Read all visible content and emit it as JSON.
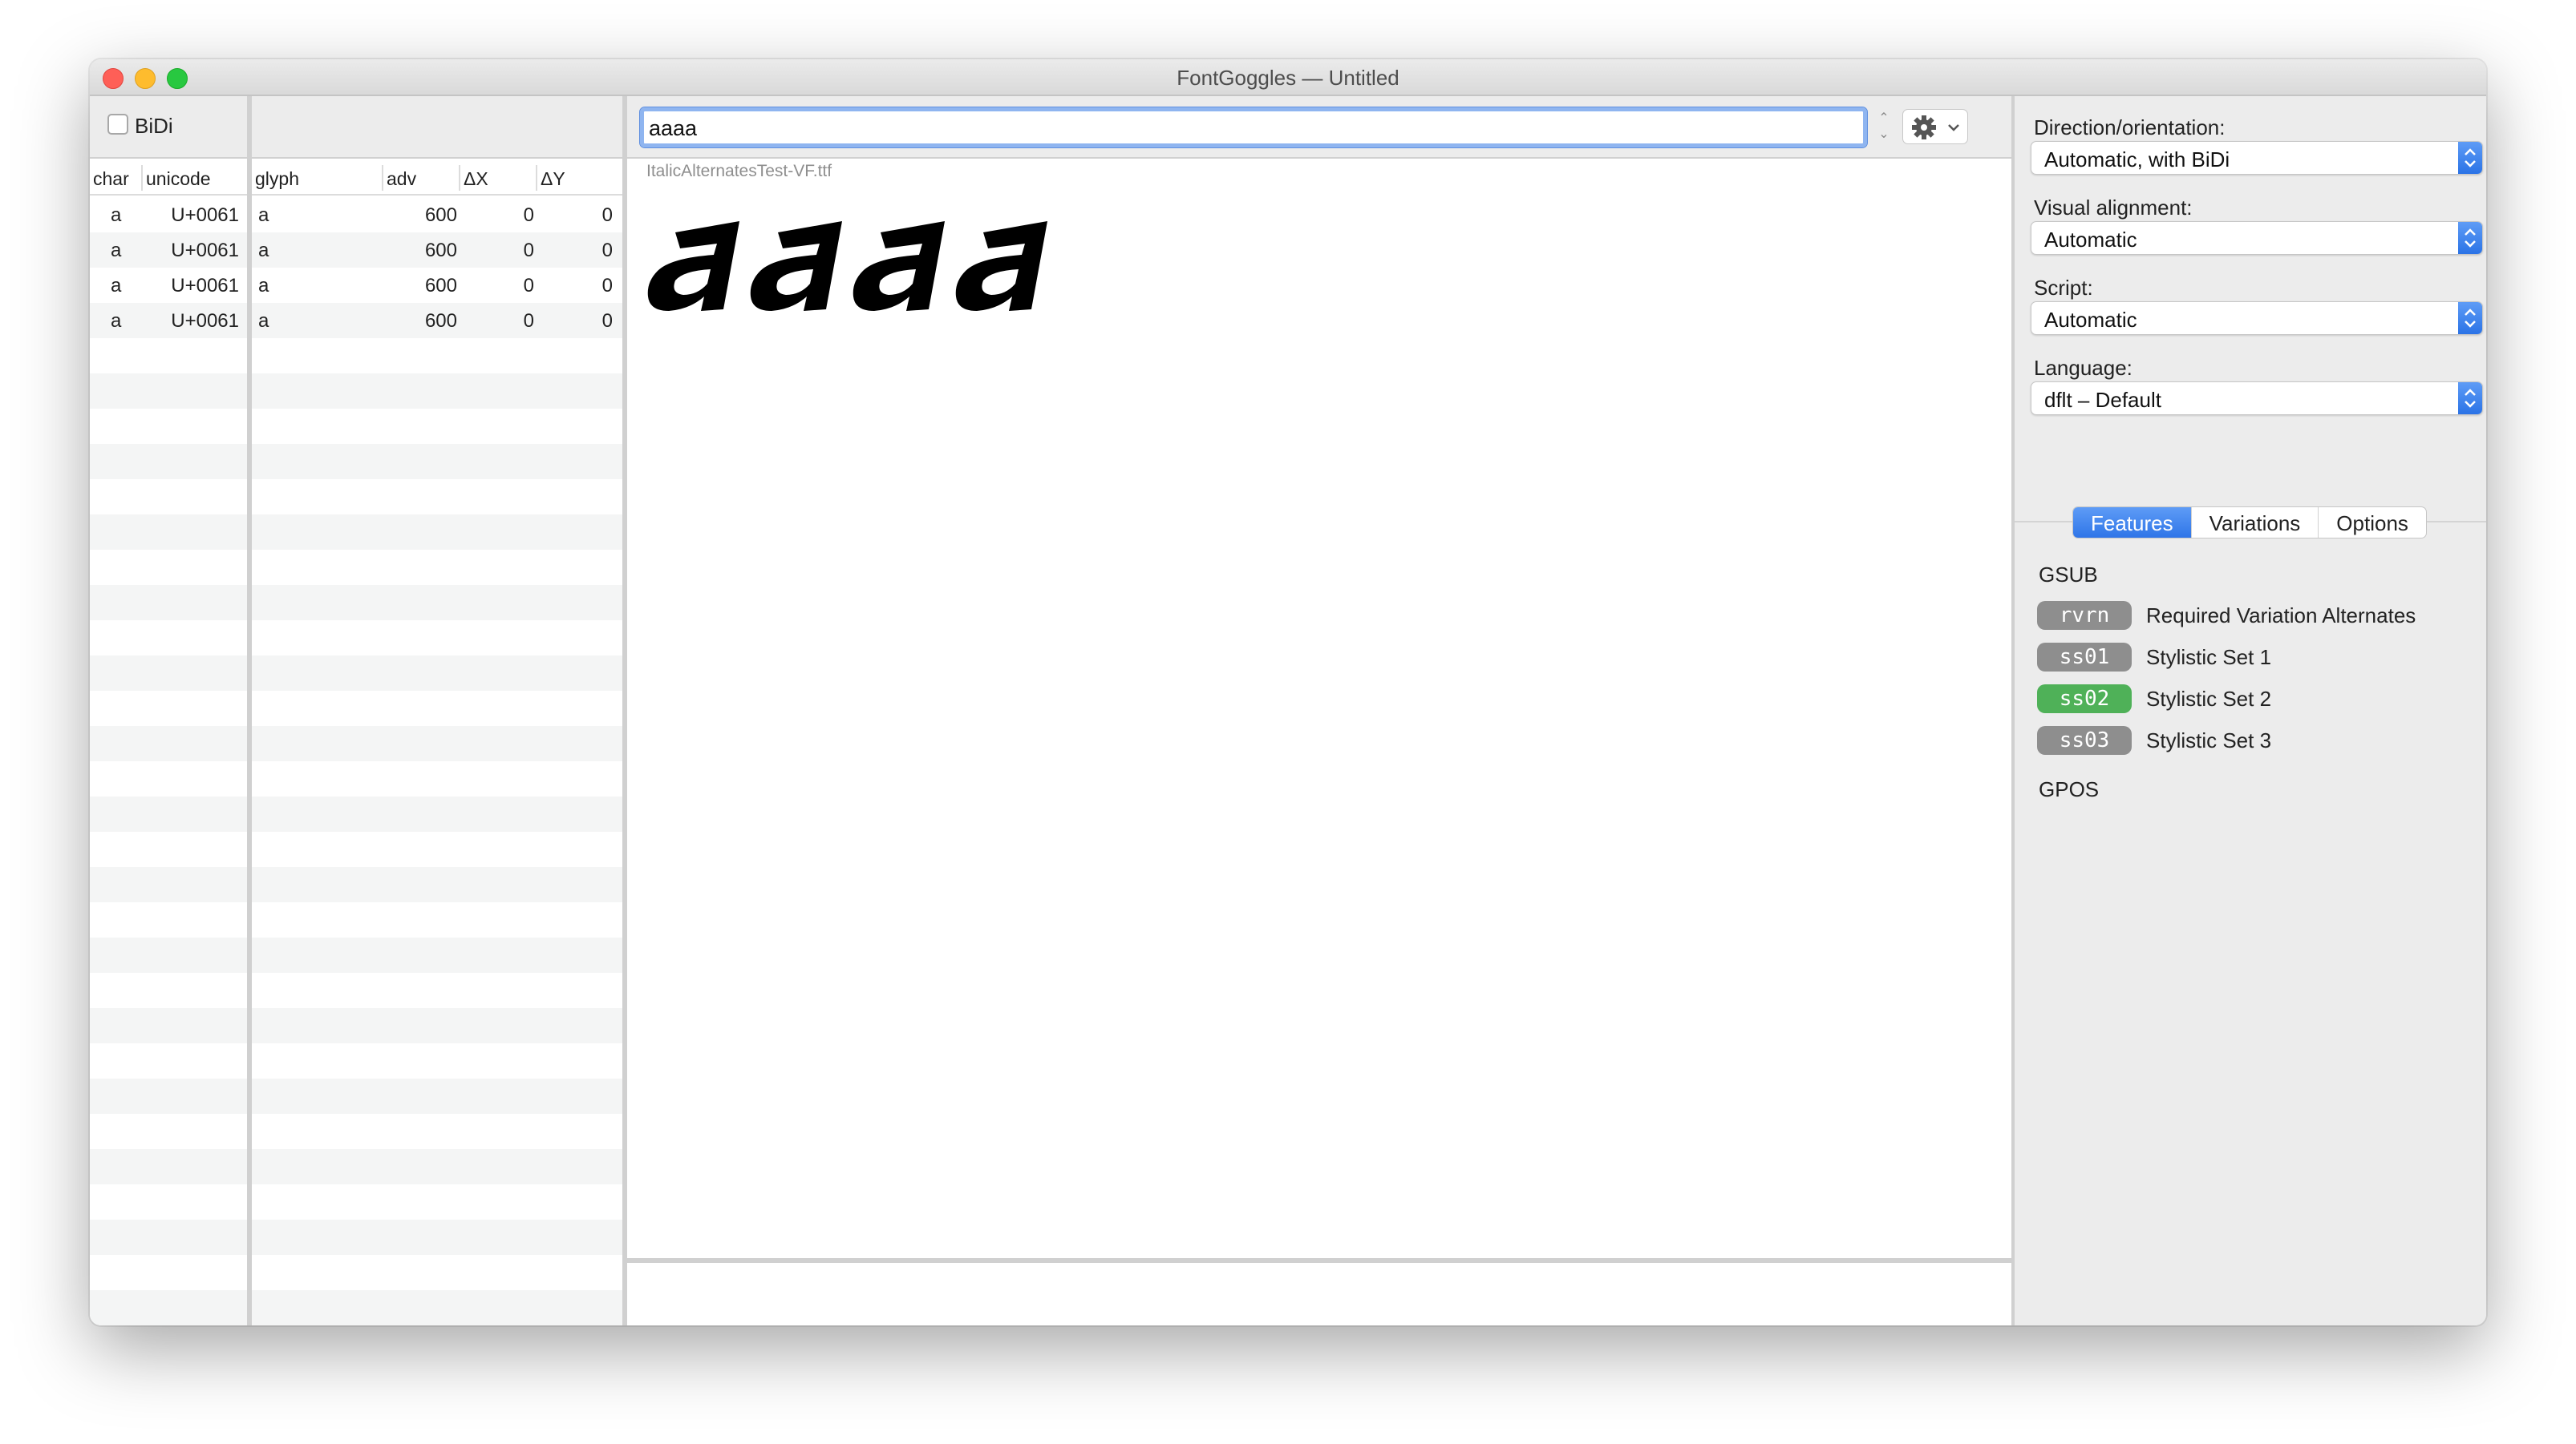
{
  "window": {
    "title": "FontGoggles — Untitled"
  },
  "bidi": {
    "label": "BiDi",
    "checked": false
  },
  "char_table": {
    "headers": [
      "char",
      "unicode"
    ],
    "rows": [
      {
        "char": "a",
        "unicode": "U+0061"
      },
      {
        "char": "a",
        "unicode": "U+0061"
      },
      {
        "char": "a",
        "unicode": "U+0061"
      },
      {
        "char": "a",
        "unicode": "U+0061"
      }
    ]
  },
  "glyph_table": {
    "headers": [
      "glyph",
      "adv",
      "ΔX",
      "ΔY"
    ],
    "rows": [
      {
        "glyph": "a",
        "adv": "600",
        "dx": "0",
        "dy": "0"
      },
      {
        "glyph": "a",
        "adv": "600",
        "dx": "0",
        "dy": "0"
      },
      {
        "glyph": "a",
        "adv": "600",
        "dx": "0",
        "dy": "0"
      },
      {
        "glyph": "a",
        "adv": "600",
        "dx": "0",
        "dy": "0"
      }
    ]
  },
  "toolbar": {
    "text_value": "aaaa",
    "settings_icon": "gear-icon"
  },
  "preview": {
    "font_file": "ItalicAlternatesTest-VF.ttf",
    "rendered_text": "aaaa"
  },
  "settings": {
    "direction": {
      "label": "Direction/orientation:",
      "value": "Automatic, with BiDi"
    },
    "alignment": {
      "label": "Visual alignment:",
      "value": "Automatic"
    },
    "script": {
      "label": "Script:",
      "value": "Automatic"
    },
    "language": {
      "label": "Language:",
      "value": "dflt – Default"
    }
  },
  "tabs": [
    {
      "label": "Features",
      "active": true
    },
    {
      "label": "Variations",
      "active": false
    },
    {
      "label": "Options",
      "active": false
    }
  ],
  "features": {
    "gsub_label": "GSUB",
    "gpos_label": "GPOS",
    "items": [
      {
        "tag": "rvrn",
        "name": "Required Variation Alternates",
        "enabled": false
      },
      {
        "tag": "ss01",
        "name": "Stylistic Set 1",
        "enabled": false
      },
      {
        "tag": "ss02",
        "name": "Stylistic Set 2",
        "enabled": true
      },
      {
        "tag": "ss03",
        "name": "Stylistic Set 3",
        "enabled": false
      }
    ]
  },
  "colors": {
    "accent": "#2f75e8",
    "feature_on": "#4fb158",
    "feature_off": "#8e8e8e"
  }
}
